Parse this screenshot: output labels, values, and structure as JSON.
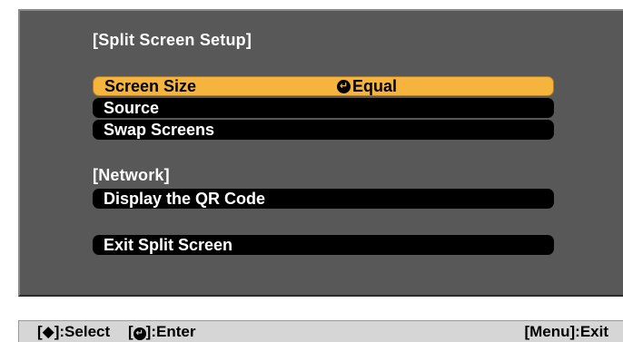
{
  "menu": {
    "title": "[Split Screen Setup]",
    "items": [
      {
        "label": "Screen Size",
        "value": "Equal",
        "selected": true
      },
      {
        "label": "Source"
      },
      {
        "label": "Swap Screens"
      }
    ],
    "network_section": {
      "title": "[Network]",
      "items": [
        {
          "label": "Display the QR Code"
        }
      ]
    },
    "exit_item": {
      "label": "Exit Split Screen"
    }
  },
  "status_bar": {
    "select_hint": "[◆]:Select",
    "enter_hint_open": "[",
    "enter_hint_close": "]:Enter",
    "exit_hint": "[Menu]:Exit"
  },
  "icons": {
    "enter": "enter-arrow-icon",
    "updown": "up-down-diamond-icon"
  },
  "colors": {
    "panel_background": "#585858",
    "selected_item": "#f4b43e",
    "item_background": "#000000",
    "status_bar": "#d6d6d6"
  }
}
